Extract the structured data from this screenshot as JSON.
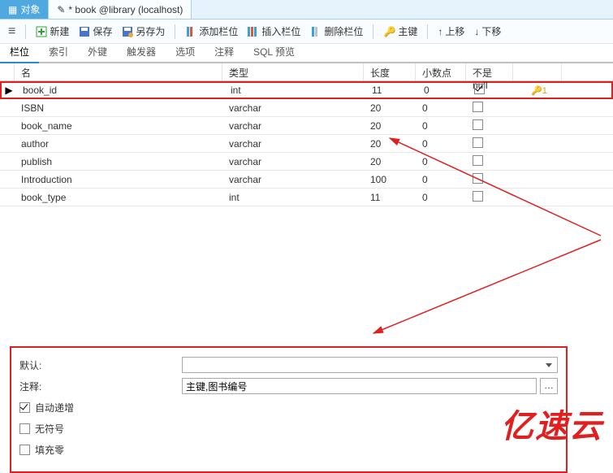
{
  "windowTabs": {
    "object": "对象",
    "editTitle": "* book @library (localhost)"
  },
  "toolbar": {
    "menu": "≡",
    "new": "新建",
    "save": "保存",
    "saveAs": "另存为",
    "addCol": "添加栏位",
    "insertCol": "插入栏位",
    "deleteCol": "删除栏位",
    "pk": "主键",
    "moveUp": "上移",
    "moveDown": "下移"
  },
  "tabs": [
    "栏位",
    "索引",
    "外键",
    "触发器",
    "选项",
    "注释",
    "SQL 预览"
  ],
  "gridHeaders": {
    "name": "名",
    "type": "类型",
    "length": "长度",
    "decimals": "小数点",
    "notNull": "不是 null"
  },
  "rows": [
    {
      "name": "book_id",
      "type": "int",
      "len": "11",
      "dec": "0",
      "notNull": true,
      "key": "1",
      "selected": true
    },
    {
      "name": "ISBN",
      "type": "varchar",
      "len": "20",
      "dec": "0",
      "notNull": false
    },
    {
      "name": "book_name",
      "type": "varchar",
      "len": "20",
      "dec": "0",
      "notNull": false
    },
    {
      "name": "author",
      "type": "varchar",
      "len": "20",
      "dec": "0",
      "notNull": false
    },
    {
      "name": "publish",
      "type": "varchar",
      "len": "20",
      "dec": "0",
      "notNull": false
    },
    {
      "name": "Introduction",
      "type": "varchar",
      "len": "100",
      "dec": "0",
      "notNull": false
    },
    {
      "name": "book_type",
      "type": "int",
      "len": "11",
      "dec": "0",
      "notNull": false
    }
  ],
  "props": {
    "defaultLabel": "默认:",
    "defaultValue": "",
    "commentLabel": "注释:",
    "commentValue": "主键,图书编号",
    "autoInc": "自动递增",
    "autoIncChecked": true,
    "unsigned": "无符号",
    "unsignedChecked": false,
    "zerofill": "填充零",
    "zerofillChecked": false
  },
  "watermark": "亿速云"
}
